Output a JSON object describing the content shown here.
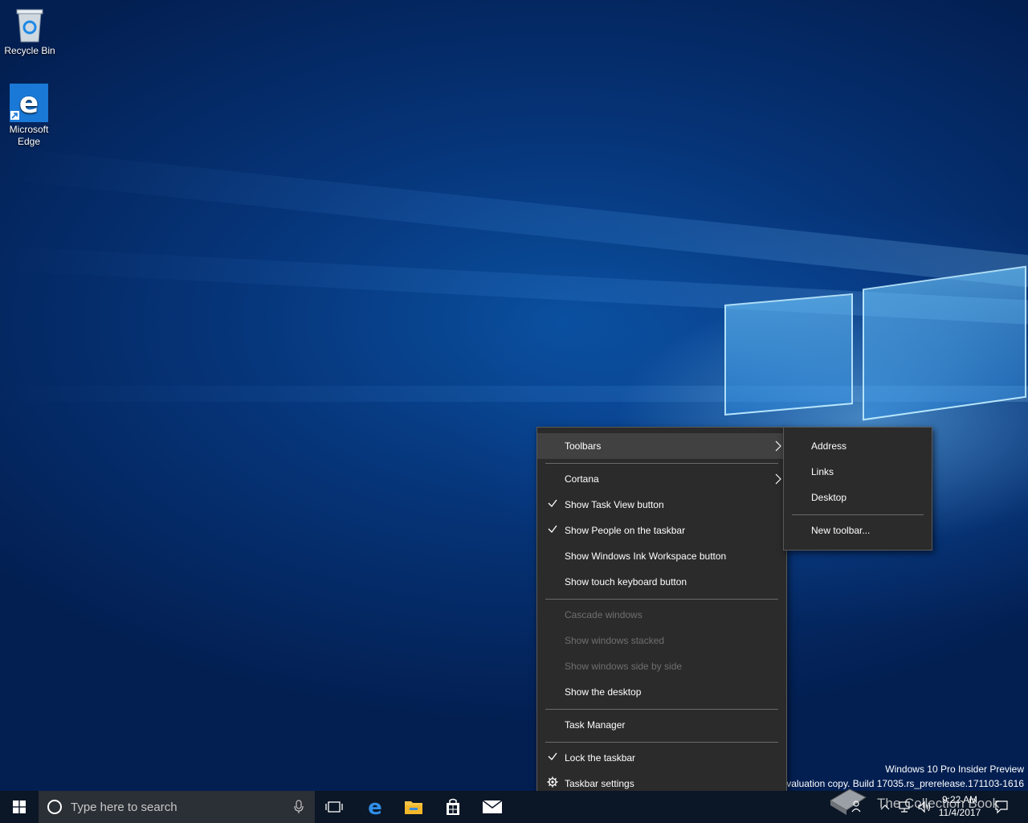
{
  "desktop": {
    "icons": [
      {
        "label": "Recycle Bin"
      },
      {
        "label": "Microsoft Edge"
      }
    ],
    "watermark": {
      "line1": "Windows 10 Pro Insider Preview",
      "line2": "Evaluation copy. Build 17035.rs_prerelease.171103-1616"
    },
    "overlay_text": "The Collection Book"
  },
  "context_menu": {
    "items": [
      {
        "label": "Toolbars",
        "submenu": true,
        "highlighted": true
      },
      {
        "label": "Cortana",
        "submenu": true
      },
      {
        "label": "Show Task View button",
        "checked": true
      },
      {
        "label": "Show People on the taskbar",
        "checked": true
      },
      {
        "label": "Show Windows Ink Workspace button"
      },
      {
        "label": "Show touch keyboard button"
      },
      {
        "label": "Cascade windows",
        "disabled": true
      },
      {
        "label": "Show windows stacked",
        "disabled": true
      },
      {
        "label": "Show windows side by side",
        "disabled": true
      },
      {
        "label": "Show the desktop"
      },
      {
        "label": "Task Manager"
      },
      {
        "label": "Lock the taskbar",
        "checked": true
      },
      {
        "label": "Taskbar settings",
        "icon": "gear-icon"
      }
    ]
  },
  "toolbars_submenu": {
    "items": [
      {
        "label": "Address"
      },
      {
        "label": "Links"
      },
      {
        "label": "Desktop"
      },
      {
        "label": "New toolbar..."
      }
    ]
  },
  "taskbar": {
    "search_placeholder": "Type here to search",
    "apps": [
      "task-view-icon",
      "edge-icon",
      "file-explorer-icon",
      "store-icon",
      "mail-icon"
    ],
    "clock": {
      "time": "9:22 AM",
      "date": "11/4/2017"
    },
    "colors": {
      "taskbar": "#0b1626",
      "search_box": "#2b2f36",
      "menu_bg": "#2b2b2b"
    }
  }
}
